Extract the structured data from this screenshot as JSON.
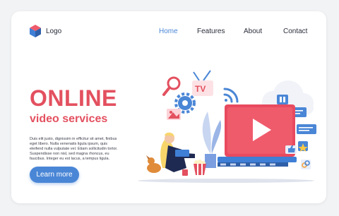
{
  "logo": {
    "text": "Logo",
    "icon": "cube-icon"
  },
  "nav": {
    "items": [
      {
        "label": "Home",
        "active": true
      },
      {
        "label": "Features",
        "active": false
      },
      {
        "label": "About",
        "active": false
      },
      {
        "label": "Contact",
        "active": false
      }
    ]
  },
  "hero": {
    "title": "ONLINE",
    "subtitle": "video services",
    "body": "Duis elit justo, dignissim in efficitur sit amet, finibus eget libero. Nulla venenatis ligula ipsum, quis eleifend nulla vulputate vel. Etiam sollicitudin tortor. Suspendisse non nisl, sed magna rhoncus, eu faucibus. Integer eu est lacus, a tempus ligula.",
    "button_label": "Learn more"
  },
  "illustration": {
    "tv_label": "TV"
  },
  "colors": {
    "accent": "#4a86d6",
    "brand": "#e3505f",
    "background": "#f2f3f5"
  }
}
